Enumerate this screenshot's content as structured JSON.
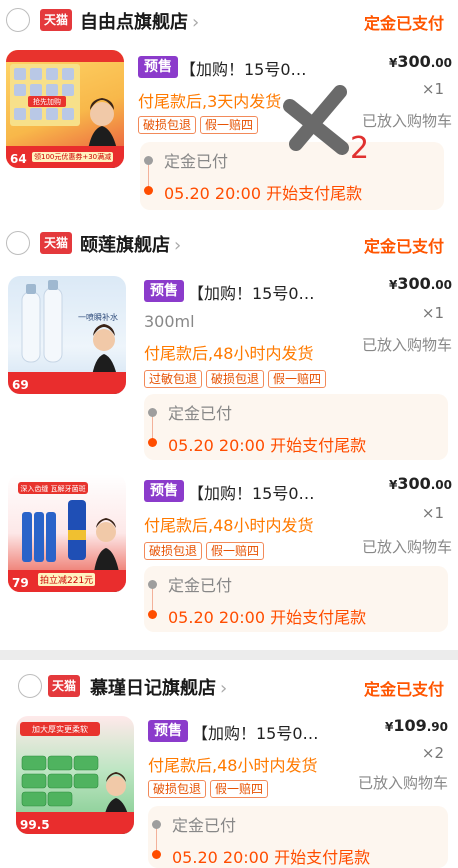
{
  "shops": [
    {
      "badge": "天猫",
      "name": "自由点旗舰店",
      "status": "定金已支付",
      "items": [
        {
          "thumb_number": "64",
          "thumb_promo": "领100元优惠券+30满减",
          "presale": "预售",
          "title": "【加购！15号0…",
          "price_int": "300",
          "price_dec": ".00",
          "qty": "×1",
          "spec": "",
          "ship": "付尾款后,3天内发货",
          "cart": "已放入购物车",
          "tags": [
            "破损包退",
            "假一赔四"
          ],
          "paid": "定金已付",
          "balance": "05.20 20:00 开始支付尾款"
        }
      ]
    },
    {
      "badge": "天猫",
      "name": "颐莲旗舰店",
      "status": "定金已支付",
      "items": [
        {
          "thumb_number": "69",
          "thumb_promo": "",
          "presale": "预售",
          "title": "【加购！15号0…",
          "price_int": "300",
          "price_dec": ".00",
          "qty": "×1",
          "spec": "300ml",
          "ship": "付尾款后,48小时内发货",
          "cart": "已放入购物车",
          "tags": [
            "过敏包退",
            "破损包退",
            "假一赔四"
          ],
          "paid": "定金已付",
          "balance": "05.20 20:00 开始支付尾款"
        },
        {
          "thumb_number": "79",
          "thumb_promo": "拍立减221元",
          "presale": "预售",
          "title": "【加购！15号0…",
          "price_int": "300",
          "price_dec": ".00",
          "qty": "×1",
          "spec": "",
          "ship": "付尾款后,48小时内发货",
          "cart": "已放入购物车",
          "tags": [
            "破损包退",
            "假一赔四"
          ],
          "paid": "定金已付",
          "balance": "05.20 20:00 开始支付尾款"
        }
      ]
    },
    {
      "badge": "天猫",
      "name": "慕瑾日记旗舰店",
      "status": "定金已支付",
      "items": [
        {
          "thumb_number": "99.5",
          "thumb_promo": "",
          "presale": "预售",
          "title": "【加购！15号0…",
          "price_int": "109",
          "price_dec": ".90",
          "qty": "×2",
          "spec": "",
          "ship": "付尾款后,48小时内发货",
          "cart": "已放入购物车",
          "tags": [
            "破损包退",
            "假一赔四"
          ],
          "paid": "定金已付",
          "balance": "05.20 20:00 开始支付尾款"
        }
      ]
    }
  ],
  "thumb_texts": {
    "t0_banner": "抢先加购",
    "t1_label": "一喷瞬补水",
    "t2_head": "深入齿缝 瓦解牙菌斑",
    "t3_head": "加大厚实更柔软"
  },
  "annotation": {
    "mark": "2"
  },
  "currency": "¥",
  "colors": {
    "accent": "#ff5500",
    "tmall": "#e4393c",
    "presale": "#8b3bcb"
  }
}
